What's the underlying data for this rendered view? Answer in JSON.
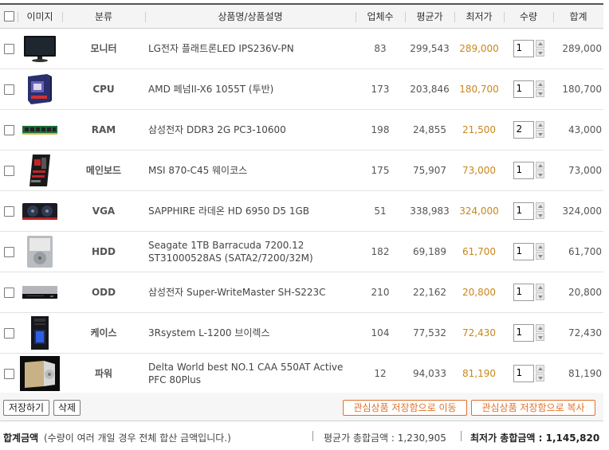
{
  "header": {
    "select_all": "",
    "image": "이미지",
    "category": "분류",
    "product": "상품명/상품설명",
    "vendors": "업체수",
    "avg_price": "평균가",
    "min_price": "최저가",
    "quantity": "수량",
    "total": "합계"
  },
  "items": [
    {
      "category": "모니터",
      "desc": "LG전자 플래트론LED IPS236V-PN",
      "vendors": "83",
      "avg": "299,543",
      "min": "289,000",
      "qty": "1",
      "total": "289,000",
      "icon": "monitor-icon"
    },
    {
      "category": "CPU",
      "desc": "AMD 페넘II-X6 1055T (투반)",
      "vendors": "173",
      "avg": "203,846",
      "min": "180,700",
      "qty": "1",
      "total": "180,700",
      "icon": "cpu-box-icon"
    },
    {
      "category": "RAM",
      "desc": "삼성전자 DDR3 2G PC3-10600",
      "vendors": "198",
      "avg": "24,855",
      "min": "21,500",
      "qty": "2",
      "total": "43,000",
      "icon": "ram-stick-icon"
    },
    {
      "category": "메인보드",
      "desc": "MSI 870-C45 웨이코스",
      "vendors": "175",
      "avg": "75,907",
      "min": "73,000",
      "qty": "1",
      "total": "73,000",
      "icon": "motherboard-icon"
    },
    {
      "category": "VGA",
      "desc": "SAPPHIRE 라데온 HD 6950 D5 1GB",
      "vendors": "51",
      "avg": "338,983",
      "min": "324,000",
      "qty": "1",
      "total": "324,000",
      "icon": "graphics-card-icon"
    },
    {
      "category": "HDD",
      "desc": "Seagate 1TB Barracuda 7200.12 ST31000528AS (SATA2/7200/32M)",
      "vendors": "182",
      "avg": "69,189",
      "min": "61,700",
      "qty": "1",
      "total": "61,700",
      "icon": "hard-drive-icon"
    },
    {
      "category": "ODD",
      "desc": "삼성전자 Super-WriteMaster SH-S223C",
      "vendors": "210",
      "avg": "22,162",
      "min": "20,800",
      "qty": "1",
      "total": "20,800",
      "icon": "optical-drive-icon"
    },
    {
      "category": "케이스",
      "desc": "3Rsystem L-1200 브이렉스",
      "vendors": "104",
      "avg": "77,532",
      "min": "72,430",
      "qty": "1",
      "total": "72,430",
      "icon": "pc-case-icon"
    },
    {
      "category": "파워",
      "desc": "Delta World best NO.1 CAA 550AT Active PFC 80Plus",
      "vendors": "12",
      "avg": "94,033",
      "min": "81,190",
      "qty": "1",
      "total": "81,190",
      "icon": "power-supply-icon"
    }
  ],
  "buttons": {
    "save": "저장하기",
    "delete": "삭제",
    "move_to_wishlist": "관심상품 저장함으로 이동",
    "copy_to_wishlist": "관심상품 저장함으로 복사"
  },
  "summary": {
    "label": "합계금액",
    "note": "(수량이 여러 개일 경우 전체 합산 금액입니다.)",
    "avg_total": "평균가 총합금액 : 1,230,905",
    "min_total": "최저가 총합금액 : 1,145,820"
  },
  "colors": {
    "min_price": "#c8871a",
    "button_accent": "#e0702a"
  }
}
